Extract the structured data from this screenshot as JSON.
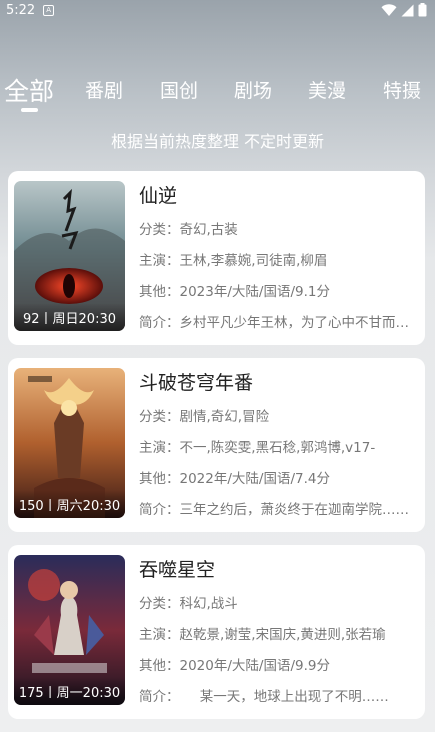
{
  "status_bar": {
    "time": "5:22",
    "notification_glyph": "A"
  },
  "tabs": [
    {
      "label": "全部",
      "active": true
    },
    {
      "label": "番剧",
      "active": false
    },
    {
      "label": "国创",
      "active": false
    },
    {
      "label": "剧场",
      "active": false
    },
    {
      "label": "美漫",
      "active": false
    },
    {
      "label": "特摄",
      "active": false
    }
  ],
  "subtitle": "根据当前热度整理 不定时更新",
  "items": [
    {
      "title": "仙逆",
      "badge": "92丨周日20:30",
      "genre": "分类：奇幻,古装",
      "cast": "主演：王林,李慕婉,司徒南,柳眉",
      "other": "其他：2023年/大陆/国语/9.1分",
      "intro": "简介：乡村平凡少年王林，为了心中不甘而踏上修仙之路……"
    },
    {
      "title": "斗破苍穹年番",
      "badge": "150丨周六20:30",
      "genre": "分类：剧情,奇幻,冒险",
      "cast": "主演：不一,陈奕雯,黑石稔,郭鸿博,v17-",
      "other": "其他：2022年/大陆/国语/7.4分",
      "intro": "简介：三年之约后，萧炎终于在迦南学院……"
    },
    {
      "title": "吞噬星空",
      "badge": "175丨周一20:30",
      "genre": "分类：科幻,战斗",
      "cast": "主演：赵乾景,谢莹,宋国庆,黄进则,张若瑜",
      "other": "其他：2020年/大陆/国语/9.9分",
      "intro": "简介：　　某一天，地球上出现了不明……"
    }
  ],
  "colors": {
    "card_bg": "#ffffff",
    "title_text": "#222222",
    "meta_text": "#777777",
    "header_text": "#ffffff"
  }
}
